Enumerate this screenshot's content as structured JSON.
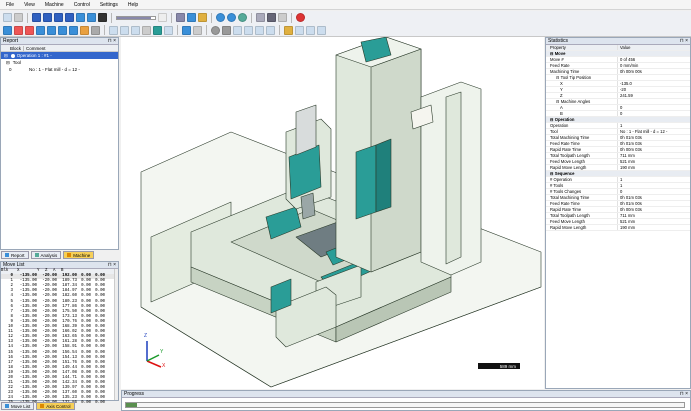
{
  "menu": [
    "File",
    "View",
    "Machine",
    "Control",
    "Settings",
    "Help"
  ],
  "report": {
    "title": "Report",
    "columns": {
      "block": "Block",
      "comment": "Comment"
    },
    "rows": [
      {
        "block": "",
        "comment": "Operation 1 : #1 -"
      },
      {
        "block": "",
        "comment": "Tool"
      },
      {
        "block": "0",
        "comment": "No : 1 - Flat mill - d = 12 -"
      }
    ],
    "tabs": [
      "Report",
      "Analysis",
      "Machine"
    ]
  },
  "move_list": {
    "title": "Move List",
    "columns": [
      "Blk",
      "X",
      "Y",
      "Z",
      "A",
      "B"
    ],
    "highlight": [
      "0",
      "-135.00",
      "-20.00",
      "192.00",
      "0.00",
      "0.00"
    ],
    "rows": [
      [
        "1",
        "-135.00",
        "-20.00",
        "189.73",
        "0.00",
        "0.00"
      ],
      [
        "2",
        "-135.00",
        "-20.00",
        "187.34",
        "0.00",
        "0.00"
      ],
      [
        "3",
        "-135.00",
        "-20.00",
        "184.97",
        "0.00",
        "0.00"
      ],
      [
        "4",
        "-135.00",
        "-20.00",
        "182.60",
        "0.00",
        "0.00"
      ],
      [
        "5",
        "-135.00",
        "-20.00",
        "180.23",
        "0.00",
        "0.00"
      ],
      [
        "6",
        "-135.00",
        "-20.00",
        "177.86",
        "0.00",
        "0.00"
      ],
      [
        "7",
        "-135.00",
        "-20.00",
        "175.50",
        "0.00",
        "0.00"
      ],
      [
        "8",
        "-135.00",
        "-20.00",
        "173.13",
        "0.00",
        "0.00"
      ],
      [
        "9",
        "-135.00",
        "-20.00",
        "170.76",
        "0.00",
        "0.00"
      ],
      [
        "10",
        "-135.00",
        "-20.00",
        "168.39",
        "0.00",
        "0.00"
      ],
      [
        "11",
        "-135.00",
        "-20.00",
        "166.02",
        "0.00",
        "0.00"
      ],
      [
        "12",
        "-135.00",
        "-20.00",
        "163.65",
        "0.00",
        "0.00"
      ],
      [
        "13",
        "-135.00",
        "-20.00",
        "161.28",
        "0.00",
        "0.00"
      ],
      [
        "14",
        "-135.00",
        "-20.00",
        "158.91",
        "0.00",
        "0.00"
      ],
      [
        "15",
        "-135.00",
        "-20.00",
        "156.54",
        "0.00",
        "0.00"
      ],
      [
        "16",
        "-135.00",
        "-20.00",
        "154.13",
        "0.00",
        "0.00"
      ],
      [
        "17",
        "-135.00",
        "-20.00",
        "151.76",
        "0.00",
        "0.00"
      ],
      [
        "18",
        "-135.00",
        "-20.00",
        "149.44",
        "0.00",
        "0.00"
      ],
      [
        "19",
        "-135.00",
        "-20.00",
        "147.08",
        "0.00",
        "0.00"
      ],
      [
        "20",
        "-135.00",
        "-20.00",
        "144.71",
        "0.00",
        "0.00"
      ],
      [
        "21",
        "-135.00",
        "-20.00",
        "142.34",
        "0.00",
        "0.00"
      ],
      [
        "22",
        "-135.00",
        "-20.00",
        "139.97",
        "0.00",
        "0.00"
      ],
      [
        "23",
        "-135.00",
        "-20.00",
        "137.60",
        "0.00",
        "0.00"
      ],
      [
        "24",
        "-135.00",
        "-20.00",
        "135.23",
        "0.00",
        "0.00"
      ],
      [
        "25",
        "-135.00",
        "-20.00",
        "132.86",
        "0.00",
        "0.00"
      ]
    ],
    "tabs": [
      "Move List",
      "Axis Control"
    ]
  },
  "viewport": {
    "scale_label": "589 mm",
    "axis_labels": {
      "z": "Z",
      "x": "X",
      "y": "Y"
    }
  },
  "statistics": {
    "title": "Statistics",
    "columns": {
      "property": "Property",
      "value": "Value"
    },
    "rows": [
      {
        "k": "Move",
        "v": "",
        "t": "sec"
      },
      {
        "k": "Move #",
        "v": "0 of 456",
        "t": ""
      },
      {
        "k": "Feed Rate",
        "v": "0 mm/min",
        "t": ""
      },
      {
        "k": "Machining Time",
        "v": "0h 00m 00s",
        "t": ""
      },
      {
        "k": "Tool Tip Position",
        "v": "",
        "t": "sub"
      },
      {
        "k": "X",
        "v": "-135.0",
        "t": "sub2"
      },
      {
        "k": "Y",
        "v": "-20",
        "t": "sub2"
      },
      {
        "k": "Z",
        "v": "241.59",
        "t": "sub2"
      },
      {
        "k": "Machine Angles",
        "v": "",
        "t": "sub"
      },
      {
        "k": "A",
        "v": "0",
        "t": "sub2"
      },
      {
        "k": "B",
        "v": "0",
        "t": "sub2"
      },
      {
        "k": "Operation",
        "v": "",
        "t": "sec"
      },
      {
        "k": "Operation",
        "v": "1",
        "t": ""
      },
      {
        "k": "Tool",
        "v": "No : 1 - Flat mill - d = 12 -",
        "t": ""
      },
      {
        "k": "Total Machining Time",
        "v": "0h 01m 03s",
        "t": ""
      },
      {
        "k": "Feed Rate Time",
        "v": "0h 01m 03s",
        "t": ""
      },
      {
        "k": "Rapid Rate Time",
        "v": "0h 00m 03s",
        "t": ""
      },
      {
        "k": "Total Toolpath Length",
        "v": "711 mm",
        "t": ""
      },
      {
        "k": "Feed Move Length",
        "v": "521 mm",
        "t": ""
      },
      {
        "k": "Rapid Move Length",
        "v": "190 mm",
        "t": ""
      },
      {
        "k": "Sequence",
        "v": "",
        "t": "sec"
      },
      {
        "k": "# Operation",
        "v": "1",
        "t": ""
      },
      {
        "k": "# Tools",
        "v": "1",
        "t": ""
      },
      {
        "k": "# Tools Changes",
        "v": "0",
        "t": ""
      },
      {
        "k": "Total Machining Time",
        "v": "0h 01m 03s",
        "t": ""
      },
      {
        "k": "Feed Rate Time",
        "v": "0h 01m 00s",
        "t": ""
      },
      {
        "k": "Rapid Rate Time",
        "v": "0h 00m 03s",
        "t": ""
      },
      {
        "k": "Total Toolpath Length",
        "v": "711 mm",
        "t": ""
      },
      {
        "k": "Feed Move Length",
        "v": "521 mm",
        "t": ""
      },
      {
        "k": "Rapid Move Length",
        "v": "190 mm",
        "t": ""
      }
    ]
  },
  "progress": {
    "title": "Progress",
    "fraction": 0.02
  },
  "colors": {
    "machine_teal": "#2a9d97",
    "machine_body": "#dfe8dc",
    "selection": "#3366cc",
    "active_tab": "#f6cf58"
  }
}
